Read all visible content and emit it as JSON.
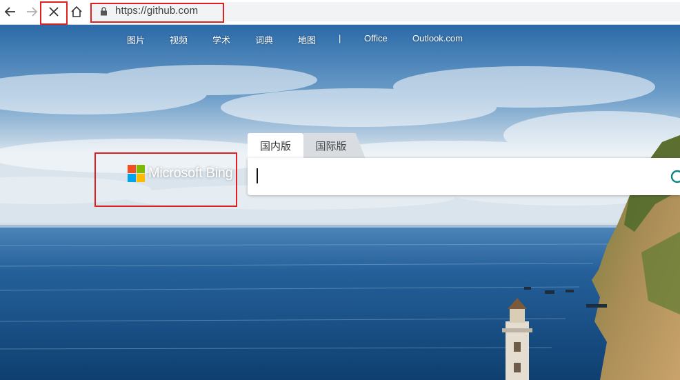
{
  "browser": {
    "url": "https://github.com",
    "icons": [
      "back-icon",
      "forward-icon",
      "stop-icon",
      "home-icon",
      "lock-icon"
    ]
  },
  "bing_nav": {
    "items": [
      "图片",
      "视频",
      "学术",
      "词典",
      "地图",
      "|",
      "Office",
      "Outlook.com"
    ]
  },
  "logo": {
    "text": "Microsoft Bing",
    "colors": [
      "#f25022",
      "#7fba00",
      "#00a4ef",
      "#ffb900"
    ]
  },
  "search": {
    "tabs": [
      "国内版",
      "国际版"
    ],
    "active_tab": "国内版",
    "value": "",
    "accent_color": "#0c8484"
  },
  "highlight_color": "#e02020"
}
